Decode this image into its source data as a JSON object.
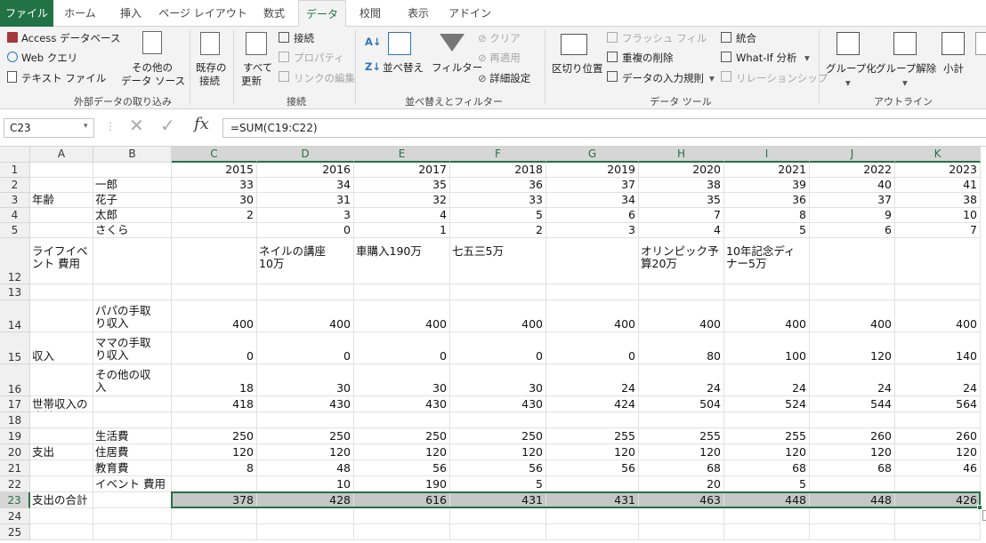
{
  "tabs": [
    "ファイル",
    "ホーム",
    "挿入",
    "ページ レイアウト",
    "数式",
    "データ",
    "校閲",
    "表示",
    "アドイン"
  ],
  "ribbon": {
    "ext": {
      "access": "Access データベース",
      "web": "Web クエリ",
      "text": "テキスト ファイル",
      "other1": "その他の",
      "other2": "データ ソース",
      "existing1": "既存の",
      "existing2": "接続",
      "group": "外部データの取り込み"
    },
    "conn": {
      "refresh1": "すべて",
      "refresh2": "更新",
      "connections": "接続",
      "properties": "プロパティ",
      "editlinks": "リンクの編集",
      "group": "接続"
    },
    "sort": {
      "sort": "並べ替え",
      "filter": "フィルター",
      "clear": "クリア",
      "reapply": "再適用",
      "advanced": "詳細設定",
      "group": "並べ替えとフィルター"
    },
    "tools": {
      "t2c": "区切り位置",
      "flash": "フラッシュ フィル",
      "dup": "重複の削除",
      "valid": "データの入力規則",
      "consolidate": "統合",
      "whatif": "What-If 分析",
      "relation": "リレーションシップ",
      "group": "データ ツール"
    },
    "outline": {
      "group_btn": "グループ化",
      "ungroup": "グループ解除",
      "subtotal": "小計",
      "group": "アウトライン"
    }
  },
  "formula_bar": {
    "name_box": "C23",
    "fx": "fx",
    "formula": "=SUM(C19:C22)"
  },
  "columns": [
    "A",
    "B",
    "C",
    "D",
    "E",
    "F",
    "G",
    "H",
    "I",
    "J",
    "K"
  ],
  "row_numbers": [
    "1",
    "2",
    "3",
    "4",
    "5",
    "12",
    "13",
    "14",
    "15",
    "16",
    "17",
    "18",
    "19",
    "20",
    "21",
    "22",
    "23",
    "24",
    "25"
  ],
  "selected_cell": "C23",
  "rows": [
    {
      "r": "1",
      "A": "",
      "B": "",
      "C": "2015",
      "D": "2016",
      "E": "2017",
      "F": "2018",
      "G": "2019",
      "H": "2020",
      "I": "2021",
      "J": "2022",
      "K": "2023"
    },
    {
      "r": "2",
      "A": "",
      "B": "一郎",
      "C": "33",
      "D": "34",
      "E": "35",
      "F": "36",
      "G": "37",
      "H": "38",
      "I": "39",
      "J": "40",
      "K": "41"
    },
    {
      "r": "3",
      "A": "年齢",
      "B": "花子",
      "C": "30",
      "D": "31",
      "E": "32",
      "F": "33",
      "G": "34",
      "H": "35",
      "I": "36",
      "J": "37",
      "K": "38"
    },
    {
      "r": "4",
      "A": "",
      "B": "太郎",
      "C": "2",
      "D": "3",
      "E": "4",
      "F": "5",
      "G": "6",
      "H": "7",
      "I": "8",
      "J": "9",
      "K": "10"
    },
    {
      "r": "5",
      "A": "",
      "B": "さくら",
      "C": "",
      "D": "0",
      "E": "1",
      "F": "2",
      "G": "3",
      "H": "4",
      "I": "5",
      "J": "6",
      "K": "7"
    },
    {
      "r": "12",
      "A": "ライフイベント 費用",
      "B": "",
      "C": "",
      "D": "ネイルの講座\n10万",
      "E": "車購入190万",
      "F": "七五三5万",
      "G": "",
      "H": "オリンピック予\n算20万",
      "I": "10年記念ディ\nナー5万",
      "J": "",
      "K": ""
    },
    {
      "r": "13",
      "A": "",
      "B": "",
      "C": "",
      "D": "",
      "E": "",
      "F": "",
      "G": "",
      "H": "",
      "I": "",
      "J": "",
      "K": ""
    },
    {
      "r": "14",
      "A": "",
      "B": "パパの手取\nり収入",
      "C": "400",
      "D": "400",
      "E": "400",
      "F": "400",
      "G": "400",
      "H": "400",
      "I": "400",
      "J": "400",
      "K": "400"
    },
    {
      "r": "15",
      "A": "収入",
      "B": "ママの手取\nり収入",
      "C": "0",
      "D": "0",
      "E": "0",
      "F": "0",
      "G": "0",
      "H": "80",
      "I": "100",
      "J": "120",
      "K": "140"
    },
    {
      "r": "16",
      "A": "",
      "B": "その他の収\n入",
      "C": "18",
      "D": "30",
      "E": "30",
      "F": "30",
      "G": "24",
      "H": "24",
      "I": "24",
      "J": "24",
      "K": "24"
    },
    {
      "r": "17",
      "A": "世帯収入の合計",
      "B": "",
      "C": "418",
      "D": "430",
      "E": "430",
      "F": "430",
      "G": "424",
      "H": "504",
      "I": "524",
      "J": "544",
      "K": "564"
    },
    {
      "r": "18",
      "A": "",
      "B": "",
      "C": "",
      "D": "",
      "E": "",
      "F": "",
      "G": "",
      "H": "",
      "I": "",
      "J": "",
      "K": ""
    },
    {
      "r": "19",
      "A": "",
      "B": "生活費",
      "C": "250",
      "D": "250",
      "E": "250",
      "F": "250",
      "G": "255",
      "H": "255",
      "I": "255",
      "J": "260",
      "K": "260"
    },
    {
      "r": "20",
      "A": "支出",
      "B": "住居費",
      "C": "120",
      "D": "120",
      "E": "120",
      "F": "120",
      "G": "120",
      "H": "120",
      "I": "120",
      "J": "120",
      "K": "120"
    },
    {
      "r": "21",
      "A": "",
      "B": "教育費",
      "C": "8",
      "D": "48",
      "E": "56",
      "F": "56",
      "G": "56",
      "H": "68",
      "I": "68",
      "J": "68",
      "K": "46"
    },
    {
      "r": "22",
      "A": "",
      "B": "イベント 費用",
      "C": "",
      "D": "10",
      "E": "190",
      "F": "5",
      "G": "",
      "H": "20",
      "I": "5",
      "J": "",
      "K": ""
    },
    {
      "r": "23",
      "A": "支出の合計",
      "B": "",
      "C": "378",
      "D": "428",
      "E": "616",
      "F": "431",
      "G": "431",
      "H": "463",
      "I": "448",
      "J": "448",
      "K": "426"
    },
    {
      "r": "24",
      "A": "",
      "B": "",
      "C": "",
      "D": "",
      "E": "",
      "F": "",
      "G": "",
      "H": "",
      "I": "",
      "J": "",
      "K": ""
    },
    {
      "r": "25",
      "A": "",
      "B": "",
      "C": "",
      "D": "",
      "E": "",
      "F": "",
      "G": "",
      "H": "",
      "I": "",
      "J": "",
      "K": ""
    }
  ],
  "colors": {
    "excel_green": "#217346",
    "selection_fill": "#c6c6c6"
  }
}
